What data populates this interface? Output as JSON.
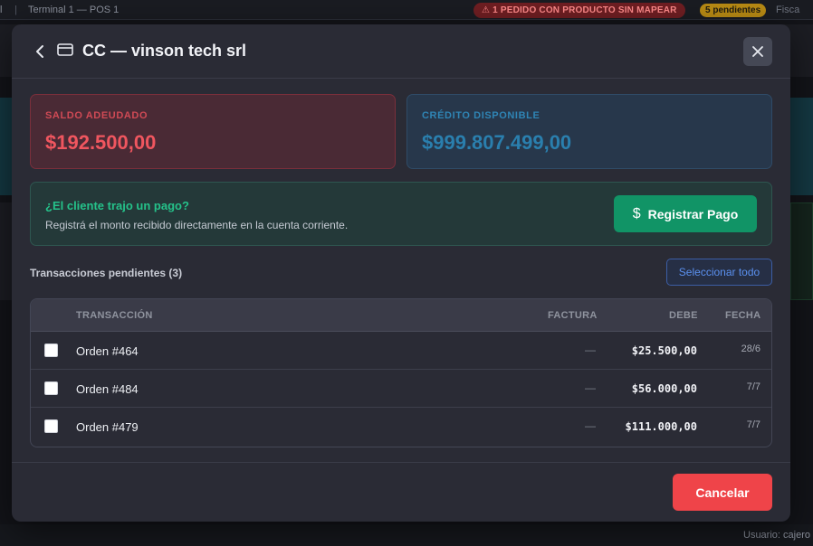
{
  "topbar": {
    "left_fragment": "l",
    "separator": "|",
    "terminal": "Terminal 1 — POS 1",
    "alert": "⚠ 1 PEDIDO CON PRODUCTO SIN MAPEAR",
    "pending": "5 pendientes",
    "fiscal": "Fisca"
  },
  "footer": {
    "user": "Usuario: cajero d"
  },
  "modal": {
    "title": "CC — vinson tech srl",
    "icons": {
      "back": "chevron-left-icon",
      "account": "credit-card-icon",
      "close": "close-icon"
    },
    "balance": {
      "label": "SALDO ADEUDADO",
      "value": "$192.500,00"
    },
    "credit": {
      "label": "CRÉDITO DISPONIBLE",
      "value": "$999.807.499,00"
    },
    "payment_prompt": {
      "title": "¿El cliente trajo un pago?",
      "subtitle": "Registrá el monto recibido directamente en la cuenta corriente.",
      "button": "Registrar Pago",
      "button_icon": "$"
    },
    "pending": {
      "label": "Transacciones pendientes (3)",
      "select_all": "Seleccionar todo",
      "columns": {
        "transaction": "TRANSACCIÓN",
        "invoice": "FACTURA",
        "debit": "DEBE",
        "date": "FECHA"
      },
      "rows": [
        {
          "transaction": "Orden #464",
          "invoice": "—",
          "debit": "$25.500,00",
          "date": "28/6",
          "checked": false
        },
        {
          "transaction": "Orden #484",
          "invoice": "—",
          "debit": "$56.000,00",
          "date": "7/7",
          "checked": false
        },
        {
          "transaction": "Orden #479",
          "invoice": "—",
          "debit": "$111.000,00",
          "date": "7/7",
          "checked": false
        }
      ]
    },
    "cancel": "Cancelar"
  },
  "colors": {
    "debt": "#f0565f",
    "credit": "#2a7fae",
    "accent_green": "#119466",
    "cancel": "#ef4449",
    "select_all": "#5b91f0"
  }
}
